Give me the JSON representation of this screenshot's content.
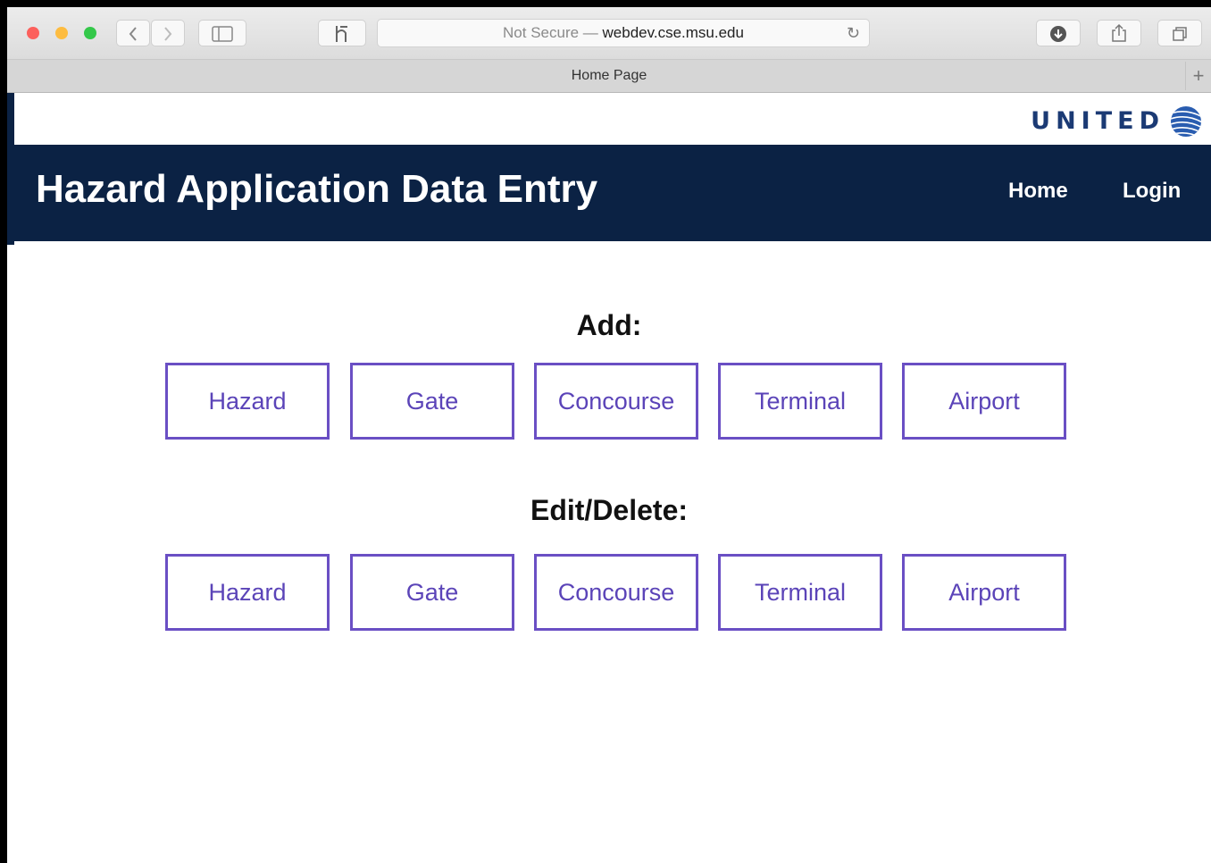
{
  "browser": {
    "not_secure_label": "Not Secure —",
    "url_domain": "webdev.cse.msu.edu",
    "tab_title": "Home Page",
    "reload_glyph": "↻",
    "newtab_glyph": "+",
    "lights": {
      "close": "#fc605c",
      "minimize": "#fdbc40",
      "zoom": "#34c84a"
    }
  },
  "brand": {
    "wordmark": "UNITED",
    "brand_color": "#1b3a74",
    "header_color": "#0b2244"
  },
  "header": {
    "title": "Hazard Application Data Entry",
    "nav": {
      "home": "Home",
      "login": "Login"
    }
  },
  "add_section": {
    "heading": "Add:",
    "buttons": [
      "Hazard",
      "Gate",
      "Concourse",
      "Terminal",
      "Airport"
    ]
  },
  "edit_section": {
    "heading": "Edit/Delete:",
    "buttons": [
      "Hazard",
      "Gate",
      "Concourse",
      "Terminal",
      "Airport"
    ]
  },
  "accent_color": "#6a4fc4"
}
